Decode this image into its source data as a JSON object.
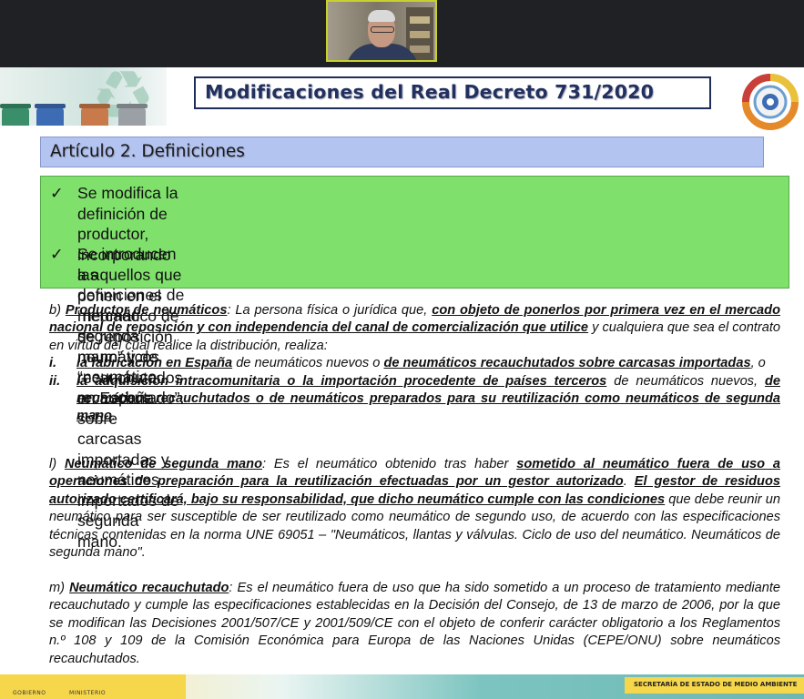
{
  "slide": {
    "title": "Modificaciones del Real Decreto 731/2020",
    "article": "Artículo 2. Definiciones",
    "bullets": [
      {
        "check": "✓",
        "lines": [
          "Se modifica la definición de productor, incorporando a aquellos que ponen en el mercado",
          "de reposición neumáticos recauchutados en España sobre carcasas importadas y",
          "neumáticos importados de segunda mano."
        ]
      },
      {
        "check": "✓",
        "lines": [
          "Se introducen las definiciones de “neumático de segunda mano” y de “neumático",
          "recauchutado”."
        ]
      }
    ],
    "def_b": {
      "prefix": "b) ",
      "term": "Productor de neumáticos",
      "t1": ": La persona física o jurídica que, ",
      "u1": "con objeto de ponerlos por primera vez en el mercado nacional de reposición y con independencia del canal de comercialización que utilice",
      "t2": " y cualquiera que sea el contrato en virtud del cual realice la distribución, realiza:",
      "items": [
        {
          "num": "i.",
          "u1": "la fabricación en España",
          "t1": " de neumáticos nuevos o ",
          "u2": "de neumáticos recauchutados sobre carcasas importadas",
          "t2": ", o"
        },
        {
          "num": "ii.",
          "u1": "la adquisición intracomunitaria o la importación procedente de países terceros",
          "t1": " de neumáticos nuevos, ",
          "u2": "de neumáticos recauchutados o de neumáticos preparados para su reutilización como neumáticos de segunda mano",
          "t2": "."
        }
      ]
    },
    "def_l": {
      "prefix": "l) ",
      "term": "Neumático de segunda mano",
      "t1": ": Es el neumático obtenido tras haber ",
      "u1": "sometido al neumático fuera de uso a operaciones de preparación para la reutilización efectuadas por un gestor autorizado",
      "t2": ". ",
      "u2": "El gestor de residuos autorizado certificará, bajo su responsabilidad, que dicho neumático cumple con las condiciones",
      "t3": " que debe reunir un neumático para ser susceptible de ser reutilizado como neumático de segundo uso, de acuerdo con las especificaciones técnicas contenidas en la norma UNE 69051 – \"Neumáticos, llantas y válvulas. Ciclo de uso del neumático. Neumáticos de segunda mano\"."
    },
    "def_m": {
      "prefix": "m) ",
      "term": "Neumático recauchutado",
      "t1": ": Es el neumático fuera de uso que ha sido sometido a un proceso de tratamiento mediante recauchutado y cumple las especificaciones establecidas en la Decisión del Consejo, de 13 de marzo de 2006, por la que se modifican las Decisiones 2001/507/CE y 2001/509/CE con el objeto de conferir carácter obligatorio a los Reglamentos n.º 108 y 109 de la Comisión Económica para Europa de las Naciones Unidas (CEPE/ONU) sobre neumáticos recauchutados."
    },
    "footer": {
      "gov1": "GOBIERNO",
      "gov2": "MINISTERIO",
      "secretaria": "SECRETARÍA DE ESTADO DE MEDIO AMBIENTE"
    }
  },
  "colors": {
    "title_text": "#21305e",
    "article_bg": "#b4c4f0",
    "green_box": "#7fe06c",
    "footer_yellow": "#f6d64a"
  },
  "icons": {
    "recycle": "♻"
  }
}
